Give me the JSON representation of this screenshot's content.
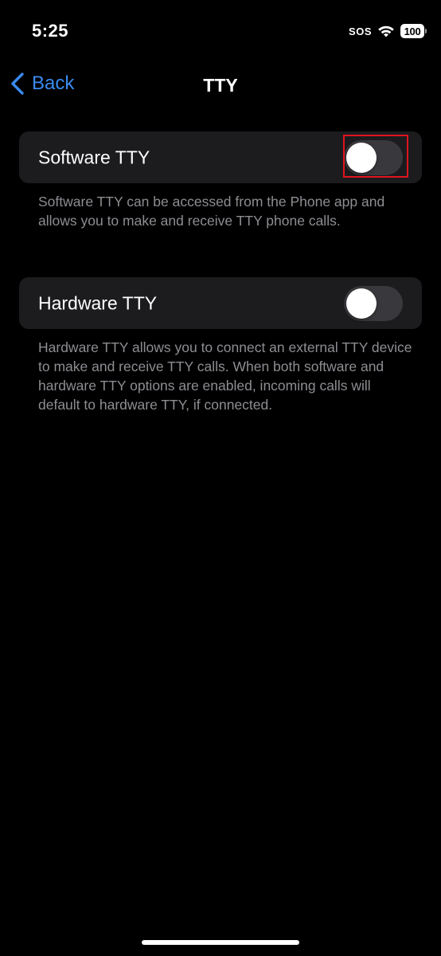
{
  "status_bar": {
    "time": "5:25",
    "sos": "SOS",
    "battery_level": "100",
    "wifi_icon": "wifi-icon"
  },
  "nav": {
    "back_label": "Back",
    "title": "TTY"
  },
  "settings": {
    "software_tty": {
      "label": "Software TTY",
      "enabled": false,
      "highlighted": true,
      "highlight_color": "#e0141e",
      "footer": "Software TTY can be accessed from the Phone app and allows you to make and receive TTY phone calls."
    },
    "hardware_tty": {
      "label": "Hardware TTY",
      "enabled": false,
      "footer": "Hardware TTY allows you to connect an external TTY device to make and receive TTY calls. When both software and hardware TTY options are enabled, incoming calls will default to hardware TTY, if connected."
    }
  },
  "colors": {
    "background": "#000000",
    "cell_background": "#1c1c1e",
    "accent": "#3a8bf0",
    "toggle_off": "#39393d",
    "secondary_text": "#8d8d93"
  }
}
